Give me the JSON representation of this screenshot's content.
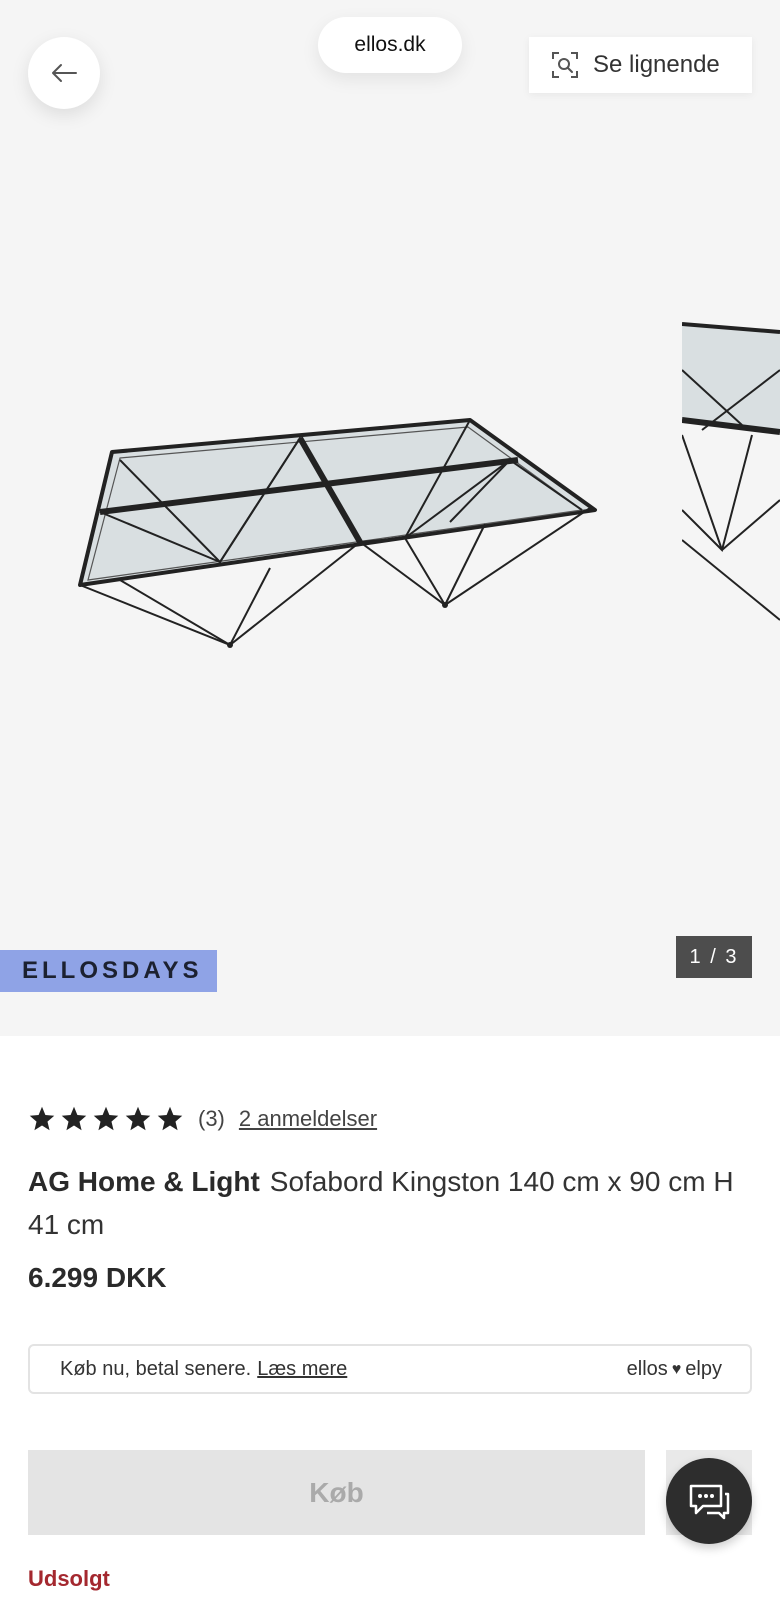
{
  "browser": {
    "url": "ellos.dk"
  },
  "header": {
    "similar_label": "Se lignende"
  },
  "gallery": {
    "badge": "ELLOSDAYS",
    "counter": "1 / 3",
    "current": 1,
    "total": 3
  },
  "product": {
    "rating": 5,
    "rating_count": "(3)",
    "reviews_link": "2 anmeldelser",
    "brand": "AG Home & Light",
    "name": "Sofabord Kingston 140 cm x 90 cm H 41 cm",
    "price": "6.299 DKK",
    "stock_status": "Udsolgt"
  },
  "payment": {
    "text": "Køb nu, betal senere.",
    "link": "Læs mere",
    "logo_left": "ellos",
    "logo_right": "elpy"
  },
  "actions": {
    "buy_label": "Køb"
  },
  "colors": {
    "badge_bg": "#8fa3e6",
    "soldout": "#a4282f",
    "buy_disabled": "#e4e4e4"
  }
}
